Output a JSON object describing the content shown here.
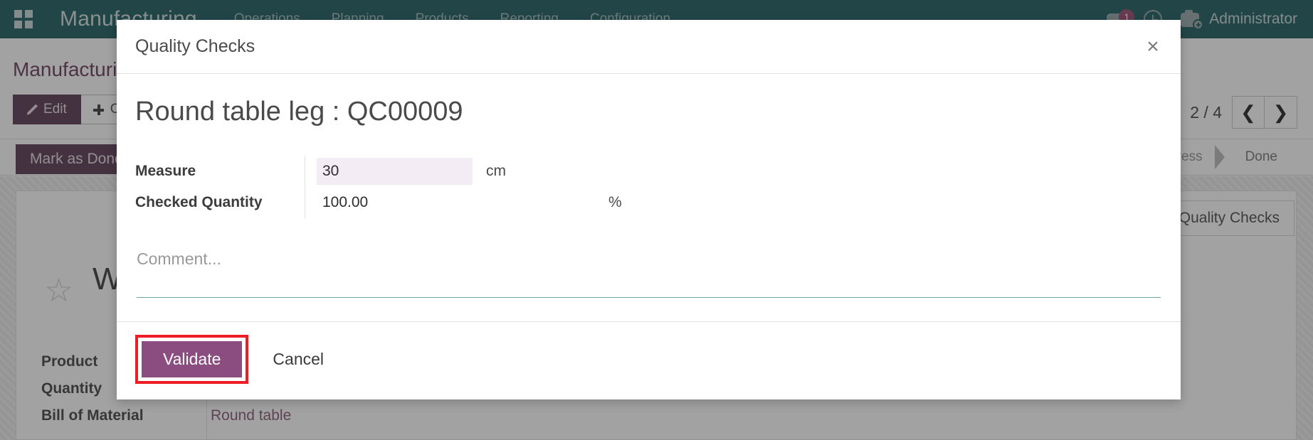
{
  "navbar": {
    "apps_icon": "apps-grid-icon",
    "brand": "Manufacturing",
    "menu": [
      "Operations",
      "Planning",
      "Products",
      "Reporting",
      "Configuration"
    ],
    "messages_icon": "chat-bubble-icon",
    "messages_count": "1",
    "activities_icon": "clock-icon",
    "avatar_icon": "user-avatar-icon",
    "user_name": "Administrator"
  },
  "breadcrumb": "Manufacturing",
  "control_panel": {
    "edit_label": "Edit",
    "edit_icon": "pencil-icon",
    "create_label": "Create",
    "create_icon": "plus-icon",
    "pager_count": "2 / 4",
    "prev_icon": "chevron-left-icon",
    "next_icon": "chevron-right-icon",
    "mark_as_done_label": "Mark as Done",
    "status_steps": [
      "Progress",
      "Done"
    ]
  },
  "record": {
    "quality_checks_button": "Quality Checks",
    "star_icon": "star-outline-icon",
    "title": "WH",
    "fields": [
      {
        "label": "Product",
        "value": "",
        "link": false
      },
      {
        "label": "Quantity",
        "value": "",
        "link": false
      },
      {
        "label": "Bill of Material",
        "value": "Round table",
        "link": true
      }
    ]
  },
  "modal": {
    "title": "Quality Checks",
    "close_icon": "close-x-icon",
    "check_title": "Round table leg : QC00009",
    "fields": [
      {
        "label": "Measure",
        "value": "30",
        "unit": "cm",
        "editable": true
      },
      {
        "label": "Checked Quantity",
        "value": "100.00",
        "unit": "%",
        "editable": false
      }
    ],
    "comment_placeholder": "Comment...",
    "comment_value": "",
    "validate_label": "Validate",
    "cancel_label": "Cancel"
  },
  "colors": {
    "navbar_bg": "#0b4f53",
    "primary_purple": "#8b4d80",
    "dark_purple": "#4e2943",
    "highlight_red": "#ee1c25",
    "measure_field_bg": "#f4ecf5",
    "comment_underline": "#6aa6a8"
  }
}
